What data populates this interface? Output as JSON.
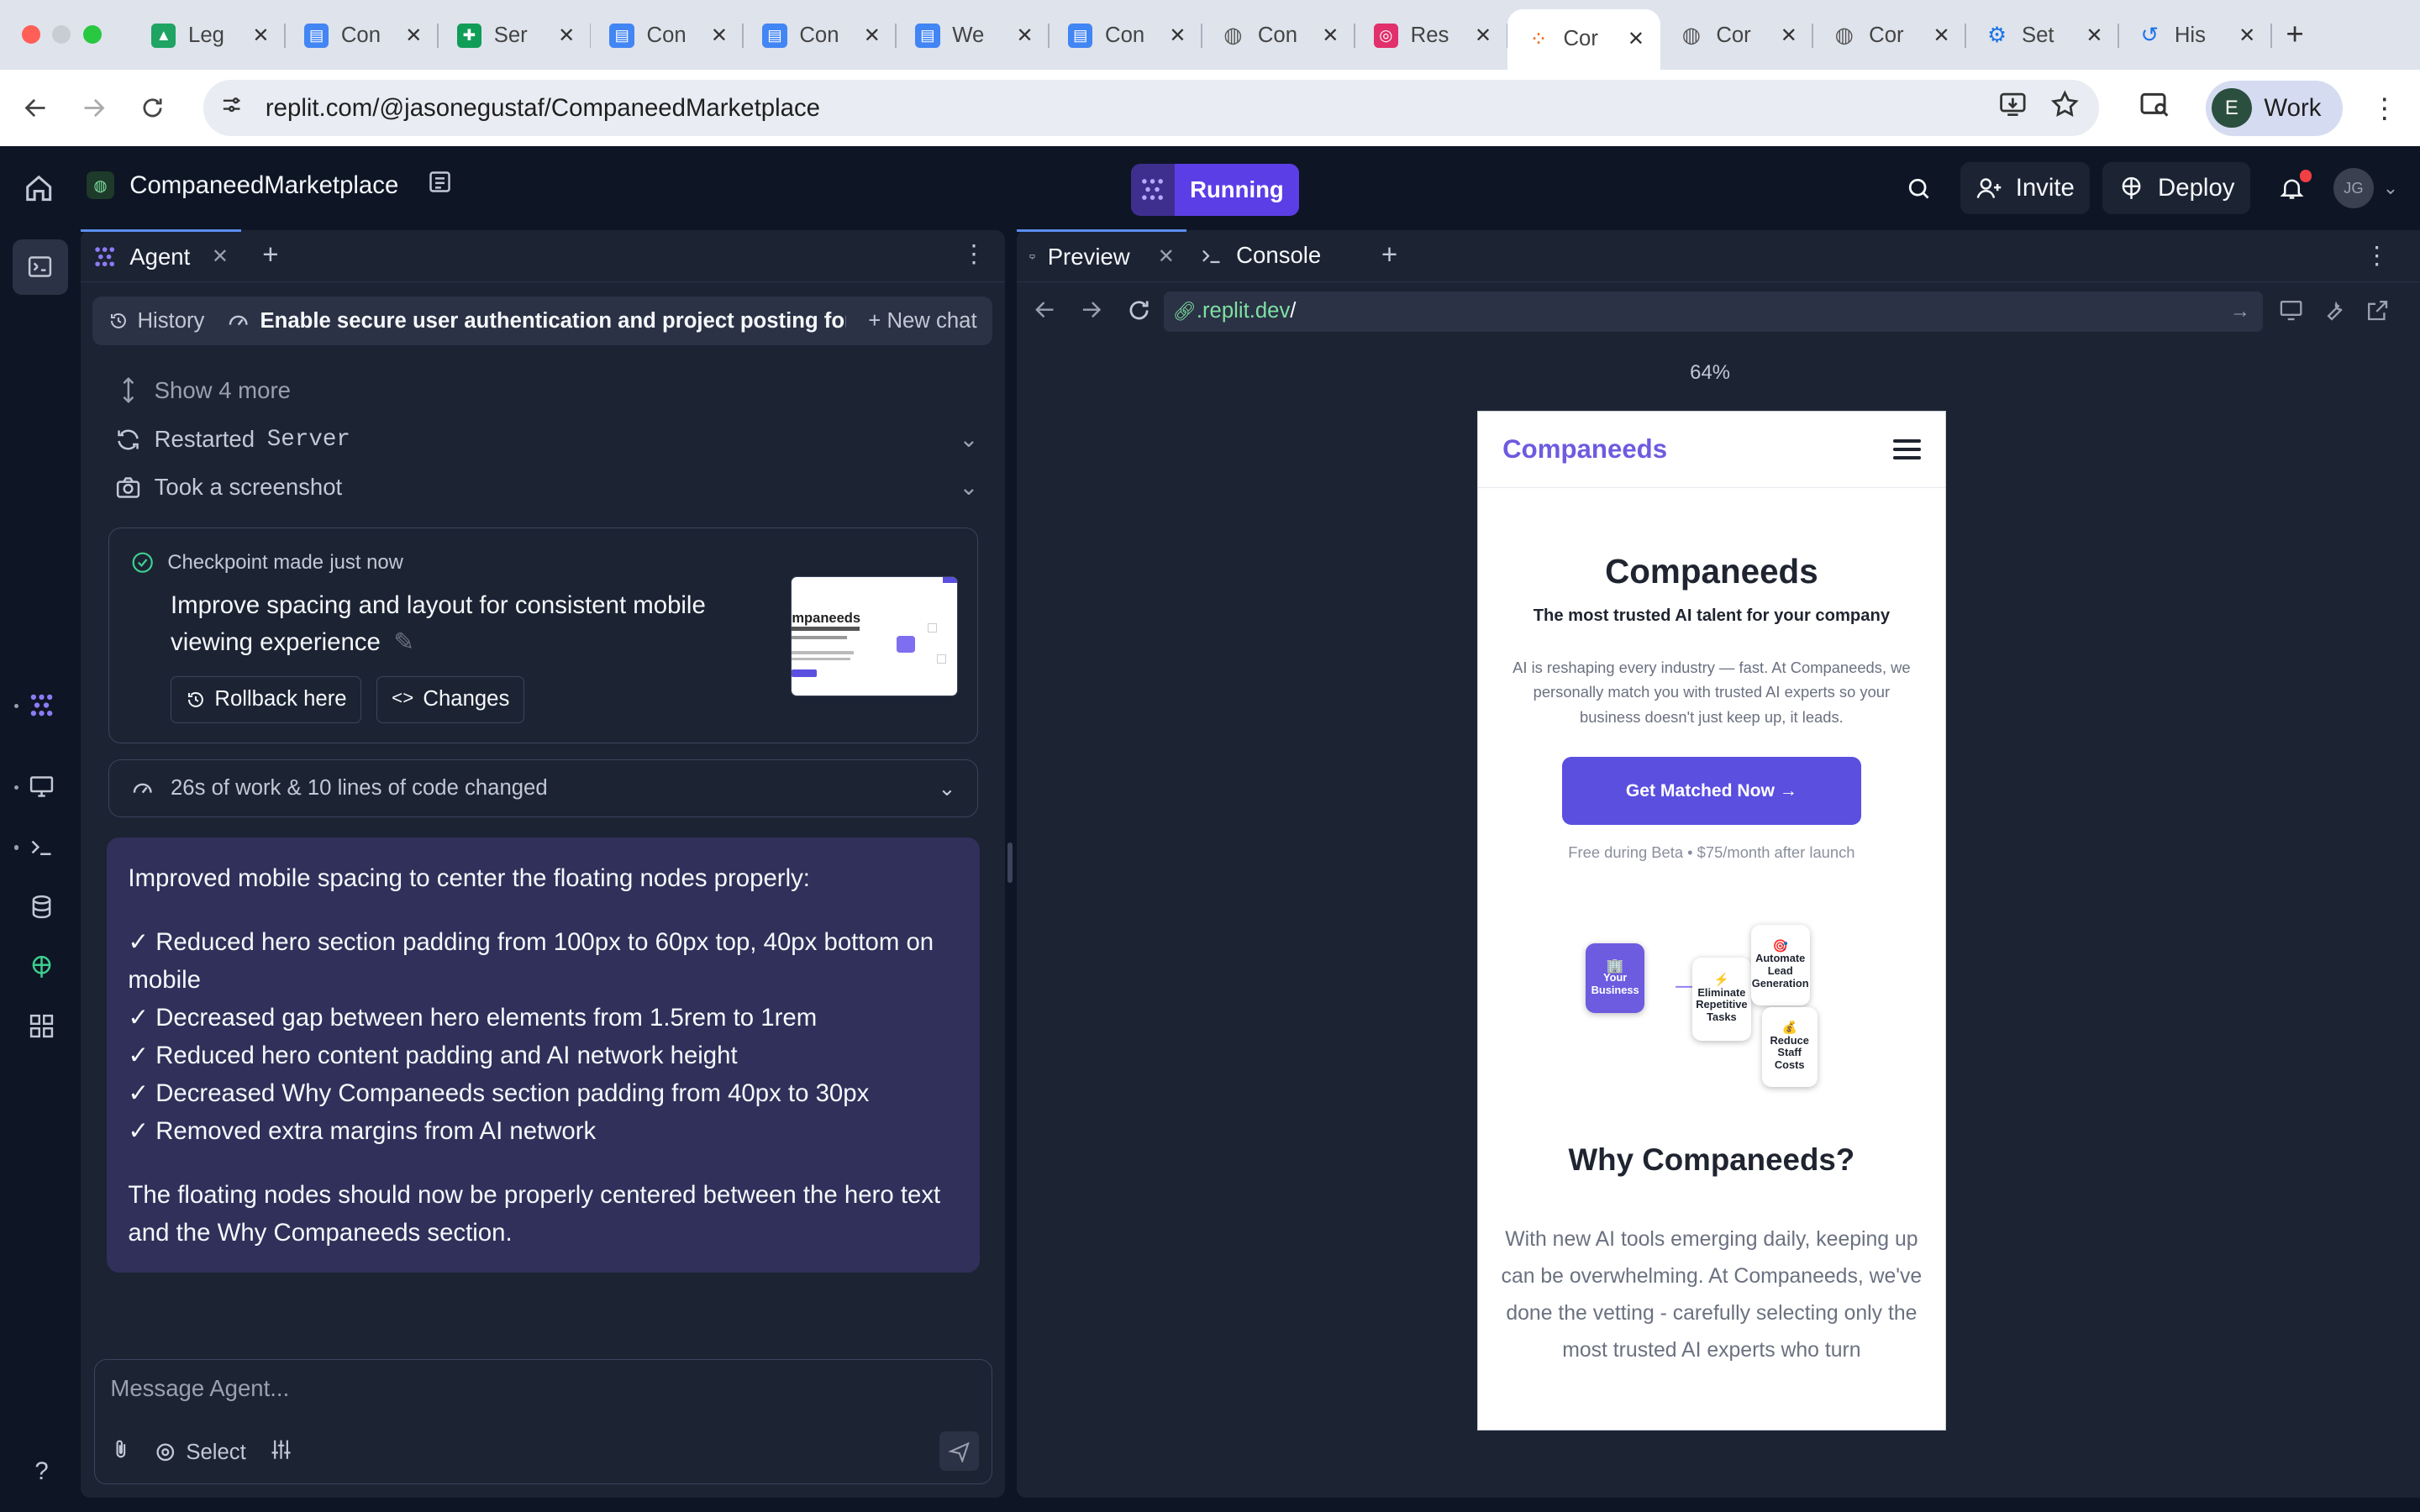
{
  "browser": {
    "tabs": [
      {
        "title": "Leg",
        "icon": "google-drive-icon",
        "color": "#1fa463"
      },
      {
        "title": "Con",
        "icon": "google-docs-icon",
        "color": "#4285f4"
      },
      {
        "title": "Ser",
        "icon": "google-sheets-icon",
        "color": "#0f9d58"
      },
      {
        "title": "Con",
        "icon": "google-docs-icon",
        "color": "#4285f4"
      },
      {
        "title": "Con",
        "icon": "google-docs-icon",
        "color": "#4285f4"
      },
      {
        "title": "We",
        "icon": "google-docs-icon",
        "color": "#4285f4"
      },
      {
        "title": "Con",
        "icon": "google-docs-icon",
        "color": "#4285f4"
      },
      {
        "title": "Con",
        "icon": "globe-icon",
        "color": "#555555"
      },
      {
        "title": "Res",
        "icon": "instagram-icon",
        "color": "#e1306c"
      },
      {
        "title": "Cor",
        "icon": "replit-icon",
        "color": "#f26207",
        "active": true
      },
      {
        "title": "Cor",
        "icon": "globe-icon",
        "color": "#555555"
      },
      {
        "title": "Cor",
        "icon": "globe-icon",
        "color": "#555555"
      },
      {
        "title": "Set",
        "icon": "gear-icon",
        "color": "#1a73e8"
      },
      {
        "title": "His",
        "icon": "history-icon",
        "color": "#1a73e8"
      }
    ],
    "url": "replit.com/@jasonegustaf/CompaneedMarketplace",
    "profile_initial": "E",
    "profile_label": "Work"
  },
  "replit": {
    "project_name": "CompaneedMarketplace",
    "run_status": "Running",
    "invite_label": "Invite",
    "deploy_label": "Deploy",
    "avatar_initials": "JG",
    "accent": "#5b3ee6"
  },
  "agent": {
    "tab_label": "Agent",
    "history_label": "History",
    "chat_title": "Enable secure user authentication and project posting for the ...",
    "new_chat_label": "New chat",
    "show_more_label": "Show 4 more",
    "actions": [
      {
        "prefix": "Restarted",
        "mono": "Server"
      },
      {
        "prefix": "Took a screenshot",
        "mono": ""
      }
    ],
    "checkpoint": {
      "made_label": "Checkpoint made",
      "time": "just now",
      "description": "Improve spacing and layout for consistent mobile viewing experience",
      "rollback_label": "Rollback here",
      "changes_label": "Changes"
    },
    "work_summary": "26s of work & 10 lines of code changed",
    "message": {
      "intro": "Improved mobile spacing to center the floating nodes properly:",
      "bullets": [
        "✓ Reduced hero section padding from 100px to 60px top, 40px bottom on mobile",
        "✓ Decreased gap between hero elements from 1.5rem to 1rem",
        "✓ Reduced hero content padding and AI network height",
        "✓ Decreased Why Companeeds section padding from 40px to 30px",
        "✓ Removed extra margins from AI network"
      ],
      "outro": "The floating nodes should now be properly centered between the hero text and the Why Companeeds section."
    },
    "composer_placeholder": "Message Agent...",
    "select_label": "Select"
  },
  "preview": {
    "tabs": [
      "Preview",
      "Console"
    ],
    "url_domain": ".replit.dev",
    "url_path": "/",
    "zoom": "64%",
    "site": {
      "logo": "Companeeds",
      "hero_title": "Companeeds",
      "hero_subtitle": "The most trusted AI talent for your company",
      "hero_paragraph": "AI is reshaping every industry — fast. At Companeeds, we personally match you with trusted AI experts so your business doesn't just keep up, it leads.",
      "cta_label": "Get Matched Now →",
      "pricing_note": "Free during Beta • $75/month after launch",
      "nodes": [
        {
          "label": "Your Business",
          "emoji": "🏢"
        },
        {
          "label": "Eliminate Repetitive Tasks",
          "emoji": "⚡"
        },
        {
          "label": "Automate Lead Generation",
          "emoji": "🎯"
        },
        {
          "label": "Reduce Staff Costs",
          "emoji": "💰"
        }
      ],
      "why_title": "Why Companeeds?",
      "why_paragraph": "With new AI tools emerging daily, keeping up can be overwhelming. At Companeeds, we've done the vetting - carefully selecting only the most trusted AI experts who turn"
    }
  }
}
